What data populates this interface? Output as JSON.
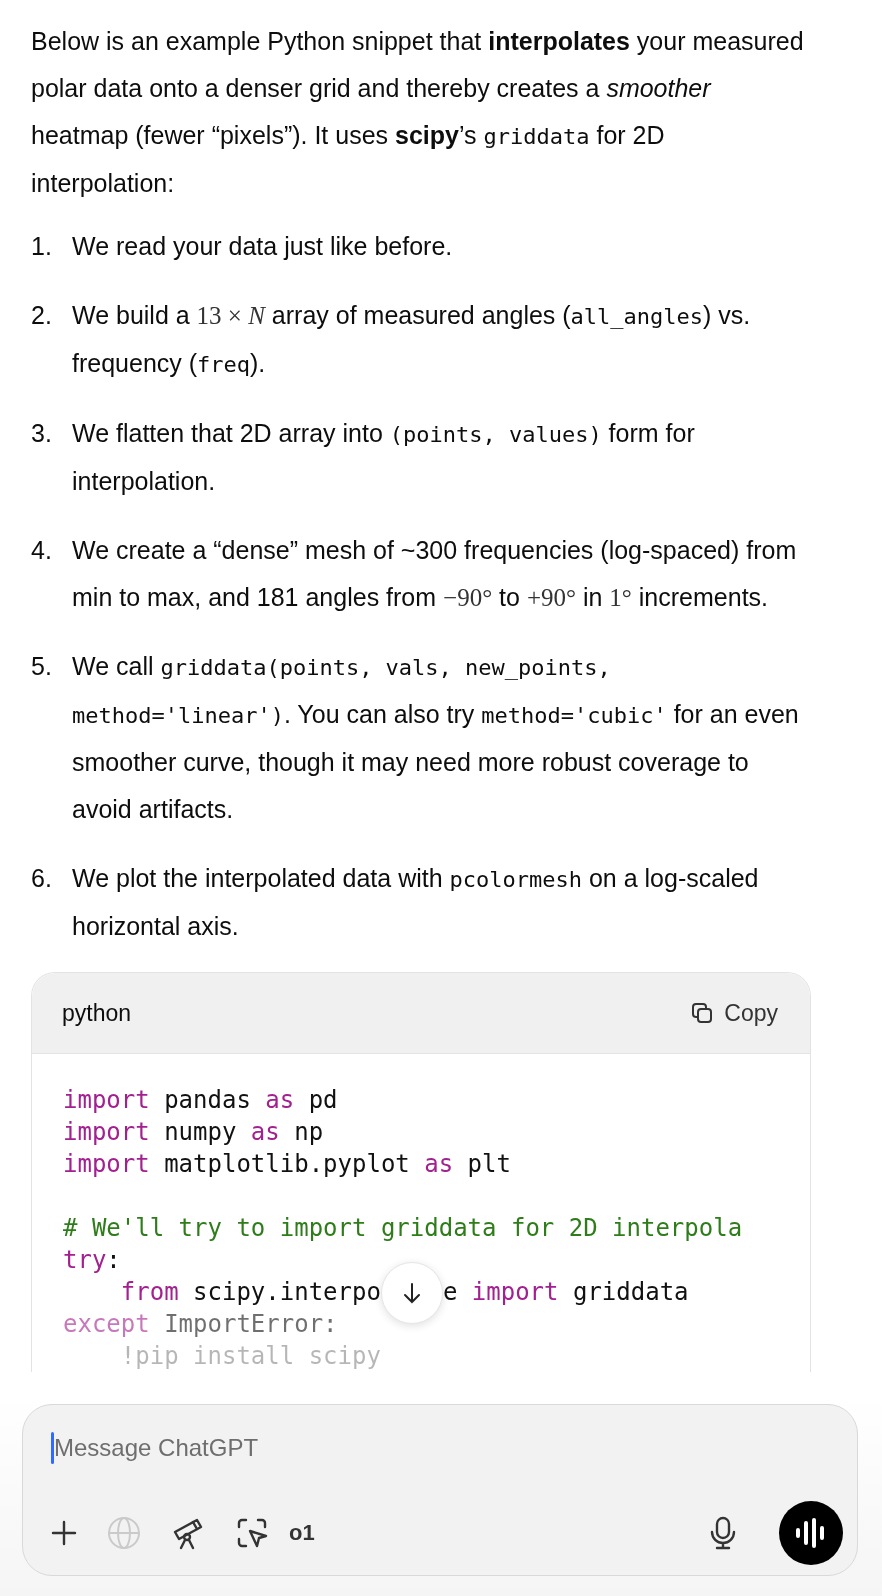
{
  "intro": [
    {
      "kind": "text",
      "text": "Below is an example Python snippet that **interpolates** your measured polar data onto a denser grid and thereby creates a *smoother* heatmap (fewer “pixels”).  It uses **scipy**’s "
    },
    {
      "kind": "code",
      "text": "griddata"
    },
    {
      "kind": "text",
      "text": " for 2D interpolation:"
    }
  ],
  "steps": [
    {
      "number": "1.",
      "segments": [
        {
          "kind": "text",
          "text": "We read your data just like before."
        }
      ]
    },
    {
      "number": "2.",
      "segments": [
        {
          "kind": "text",
          "text": "We build a "
        },
        {
          "kind": "math",
          "text": "13 × *N*"
        },
        {
          "kind": "text",
          "text": " array of measured angles ("
        },
        {
          "kind": "code",
          "text": "all_angles"
        },
        {
          "kind": "text",
          "text": ") vs. frequency ("
        },
        {
          "kind": "code",
          "text": "freq"
        },
        {
          "kind": "text",
          "text": ")."
        }
      ]
    },
    {
      "number": "3.",
      "segments": [
        {
          "kind": "text",
          "text": "We flatten that 2D array into "
        },
        {
          "kind": "code",
          "text": "(points, values)"
        },
        {
          "kind": "text",
          "text": " form for interpolation."
        }
      ]
    },
    {
      "number": "4.",
      "segments": [
        {
          "kind": "text",
          "text": "We create a “dense” mesh of ~300 frequencies (log-spaced) from min to max, and 181 angles from "
        },
        {
          "kind": "math",
          "text": "−90°"
        },
        {
          "kind": "text",
          "text": " to "
        },
        {
          "kind": "math",
          "text": "+90°"
        },
        {
          "kind": "text",
          "text": " in "
        },
        {
          "kind": "math",
          "text": "1°"
        },
        {
          "kind": "text",
          "text": " increments."
        }
      ]
    },
    {
      "number": "5.",
      "segments": [
        {
          "kind": "text",
          "text": "We call "
        },
        {
          "kind": "code",
          "text": "griddata(points, vals, new_points, method='linear')"
        },
        {
          "kind": "text",
          "text": ".  You can also try "
        },
        {
          "kind": "code",
          "text": "method='cubic'"
        },
        {
          "kind": "text",
          "text": " for an even smoother curve, though it may need more robust coverage to avoid artifacts."
        }
      ]
    },
    {
      "number": "6.",
      "segments": [
        {
          "kind": "text",
          "text": "We plot the interpolated data with "
        },
        {
          "kind": "code",
          "text": "pcolormesh"
        },
        {
          "kind": "text",
          "text": " on a log-scaled horizontal axis."
        }
      ]
    }
  ],
  "code_block": {
    "language": "python",
    "copy_label": "Copy",
    "lines": [
      [
        {
          "kind": "keyword",
          "text": "import"
        },
        {
          "kind": "plain",
          "text": " pandas "
        },
        {
          "kind": "keyword",
          "text": "as"
        },
        {
          "kind": "plain",
          "text": " pd"
        }
      ],
      [
        {
          "kind": "keyword",
          "text": "import"
        },
        {
          "kind": "plain",
          "text": " numpy "
        },
        {
          "kind": "keyword",
          "text": "as"
        },
        {
          "kind": "plain",
          "text": " np"
        }
      ],
      [
        {
          "kind": "keyword",
          "text": "import"
        },
        {
          "kind": "plain",
          "text": " matplotlib.pyplot "
        },
        {
          "kind": "keyword",
          "text": "as"
        },
        {
          "kind": "plain",
          "text": " plt"
        }
      ],
      [
        {
          "kind": "blank"
        }
      ],
      [
        {
          "kind": "comment",
          "text": "# We'll try to import griddata for 2D interpola"
        }
      ],
      [
        {
          "kind": "keyword",
          "text": "try"
        },
        {
          "kind": "plain",
          "text": ":"
        }
      ],
      [
        {
          "kind": "indent"
        },
        {
          "kind": "keyword",
          "text": "from"
        },
        {
          "kind": "plain",
          "text": " scipy.interpo"
        },
        {
          "kind": "scroll_button"
        },
        {
          "kind": "plain",
          "text": "e "
        },
        {
          "kind": "keyword",
          "text": "import"
        },
        {
          "kind": "plain",
          "text": " griddata"
        }
      ],
      [
        {
          "kind": "keyword",
          "text": "except"
        },
        {
          "kind": "plain",
          "text": " ImportError:"
        }
      ],
      [
        {
          "kind": "indent"
        },
        {
          "kind": "plain",
          "text": "!pip install scipy"
        }
      ]
    ]
  },
  "composer": {
    "placeholder": "Message ChatGPT",
    "search_disabled": true,
    "model_label": "o1"
  }
}
